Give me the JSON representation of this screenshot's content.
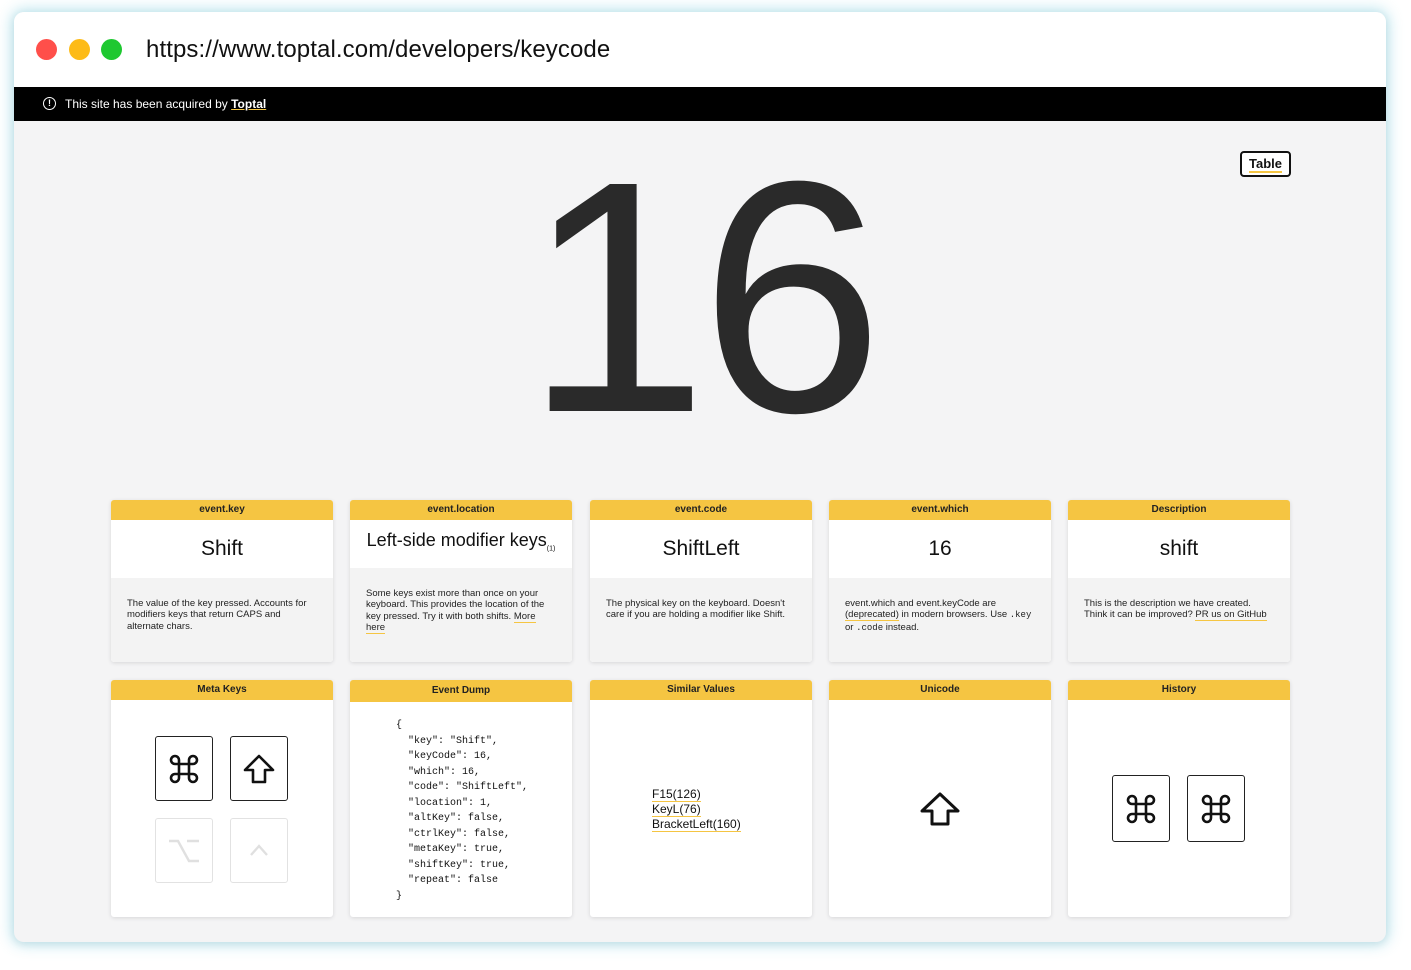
{
  "browser": {
    "url": "https://www.toptal.com/developers/keycode"
  },
  "banner": {
    "icon": "info-icon",
    "text": "This site has been acquired by ",
    "brand": "Toptal"
  },
  "table_button": "Table",
  "key_code": "16",
  "cards_row1": [
    {
      "header": "event.key",
      "value": "Shift",
      "description": "The value of the key pressed. Accounts for modifiers keys that return CAPS and alternate chars."
    },
    {
      "header": "event.location",
      "value": "Left-side modifier keys",
      "footnote": "(1)",
      "description": "Some keys exist more than once on your keyboard. This provides the location of the key pressed. Try it with both shifts.",
      "link": "More here"
    },
    {
      "header": "event.code",
      "value": "ShiftLeft",
      "description": "The physical key on the keyboard. Doesn't care if you are holding a modifier like Shift."
    },
    {
      "header": "event.which",
      "value": "16",
      "desc_part1": "event.which and event.keyCode are ",
      "desc_link": "(deprecated)",
      "desc_part2": " in modern browsers. Use ",
      "desc_code1": ".key",
      "desc_part3": " or ",
      "desc_code2": ".code",
      "desc_part4": " instead."
    },
    {
      "header": "Description",
      "value": "shift",
      "description": "This is the description we have created. Think it can be improved? ",
      "link": "PR us on GitHub"
    }
  ],
  "cards_row2": {
    "meta_keys": {
      "header": "Meta Keys",
      "keys": [
        {
          "icon": "command-icon",
          "active": true
        },
        {
          "icon": "shift-arrow-icon",
          "active": true
        },
        {
          "icon": "option-icon",
          "active": false
        },
        {
          "icon": "control-caret-icon",
          "active": false
        }
      ]
    },
    "event_dump": {
      "header": "Event Dump",
      "lines": [
        "{",
        "  \"key\": \"Shift\",",
        "  \"keyCode\": 16,",
        "  \"which\": 16,",
        "  \"code\": \"ShiftLeft\",",
        "  \"location\": 1,",
        "  \"altKey\": false,",
        "  \"ctrlKey\": false,",
        "  \"metaKey\": true,",
        "  \"shiftKey\": true,",
        "  \"repeat\": false",
        "}"
      ]
    },
    "similar_values": {
      "header": "Similar Values",
      "items": [
        "F15(126)",
        "KeyL(76)",
        "BracketLeft(160)"
      ]
    },
    "unicode": {
      "header": "Unicode",
      "icon": "shift-arrow-icon"
    },
    "history": {
      "header": "History",
      "keys": [
        "command-icon",
        "command-icon"
      ]
    }
  },
  "colors": {
    "accent": "#f5c542",
    "banner_bg": "#000000",
    "page_bg": "#f4f4f5",
    "number": "#2a2a2a"
  }
}
